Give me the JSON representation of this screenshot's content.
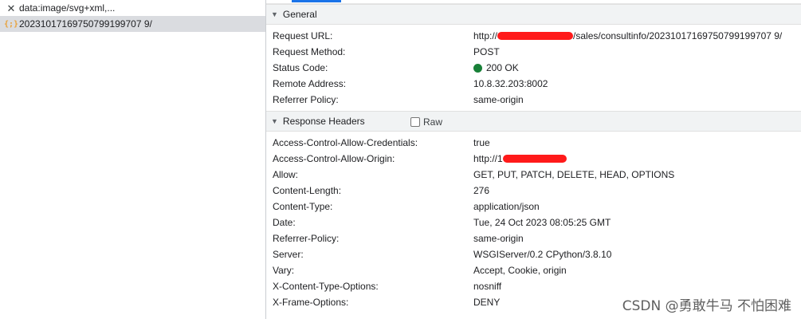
{
  "requests": [
    {
      "icon": "close-icon",
      "name": "data:image/svg+xml,..."
    },
    {
      "icon": "json-icon",
      "name": "20231017169750799199707 9/",
      "selected": true
    }
  ],
  "general": {
    "title": "General",
    "rows": [
      {
        "key": "Request URL:",
        "value_prefix": "http://",
        "value_suffix": "/sales/consultinfo/20231017169750799199707 9/"
      },
      {
        "key": "Request Method:",
        "value": "POST"
      },
      {
        "key": "Status Code:",
        "value": "200 OK",
        "status_color": "#188038"
      },
      {
        "key": "Remote Address:",
        "value": "10.8.32.203:8002"
      },
      {
        "key": "Referrer Policy:",
        "value": "same-origin"
      }
    ]
  },
  "response_headers": {
    "title": "Response Headers",
    "raw_label": "Raw",
    "rows": [
      {
        "key": "Access-Control-Allow-Credentials:",
        "value": "true"
      },
      {
        "key": "Access-Control-Allow-Origin:",
        "value_prefix": "http://1"
      },
      {
        "key": "Allow:",
        "value": "GET, PUT, PATCH, DELETE, HEAD, OPTIONS"
      },
      {
        "key": "Content-Length:",
        "value": "276"
      },
      {
        "key": "Content-Type:",
        "value": "application/json"
      },
      {
        "key": "Date:",
        "value": "Tue, 24 Oct 2023 08:05:25 GMT"
      },
      {
        "key": "Referrer-Policy:",
        "value": "same-origin"
      },
      {
        "key": "Server:",
        "value": "WSGIServer/0.2 CPython/3.8.10"
      },
      {
        "key": "Vary:",
        "value": "Accept, Cookie, origin"
      },
      {
        "key": "X-Content-Type-Options:",
        "value": "nosniff"
      },
      {
        "key": "X-Frame-Options:",
        "value": "DENY"
      }
    ]
  },
  "watermark": "CSDN @勇敢牛马 不怕困难",
  "colors": {
    "accent": "#1a73e8",
    "redaction": "#ff1a1a",
    "selected_bg": "#dadce0"
  }
}
